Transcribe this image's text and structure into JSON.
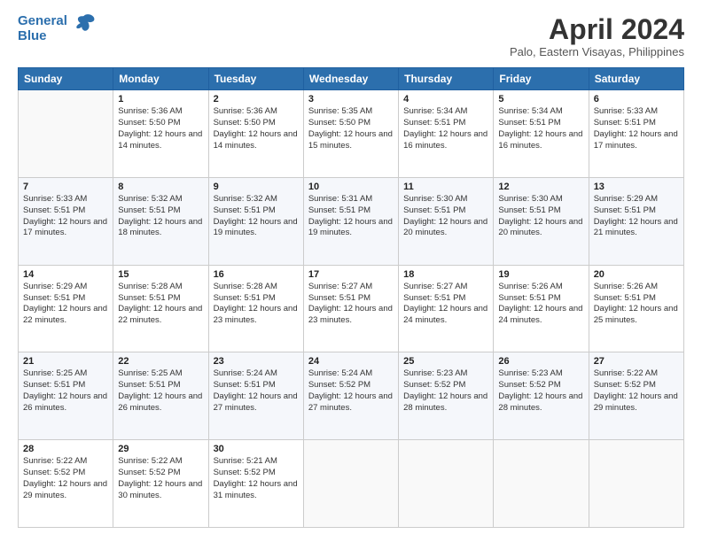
{
  "logo": {
    "line1": "General",
    "line2": "Blue"
  },
  "header": {
    "title": "April 2024",
    "subtitle": "Palo, Eastern Visayas, Philippines"
  },
  "weekdays": [
    "Sunday",
    "Monday",
    "Tuesday",
    "Wednesday",
    "Thursday",
    "Friday",
    "Saturday"
  ],
  "weeks": [
    [
      {
        "day": "",
        "sunrise": "",
        "sunset": "",
        "daylight": ""
      },
      {
        "day": "1",
        "sunrise": "Sunrise: 5:36 AM",
        "sunset": "Sunset: 5:50 PM",
        "daylight": "Daylight: 12 hours and 14 minutes."
      },
      {
        "day": "2",
        "sunrise": "Sunrise: 5:36 AM",
        "sunset": "Sunset: 5:50 PM",
        "daylight": "Daylight: 12 hours and 14 minutes."
      },
      {
        "day": "3",
        "sunrise": "Sunrise: 5:35 AM",
        "sunset": "Sunset: 5:50 PM",
        "daylight": "Daylight: 12 hours and 15 minutes."
      },
      {
        "day": "4",
        "sunrise": "Sunrise: 5:34 AM",
        "sunset": "Sunset: 5:51 PM",
        "daylight": "Daylight: 12 hours and 16 minutes."
      },
      {
        "day": "5",
        "sunrise": "Sunrise: 5:34 AM",
        "sunset": "Sunset: 5:51 PM",
        "daylight": "Daylight: 12 hours and 16 minutes."
      },
      {
        "day": "6",
        "sunrise": "Sunrise: 5:33 AM",
        "sunset": "Sunset: 5:51 PM",
        "daylight": "Daylight: 12 hours and 17 minutes."
      }
    ],
    [
      {
        "day": "7",
        "sunrise": "Sunrise: 5:33 AM",
        "sunset": "Sunset: 5:51 PM",
        "daylight": "Daylight: 12 hours and 17 minutes."
      },
      {
        "day": "8",
        "sunrise": "Sunrise: 5:32 AM",
        "sunset": "Sunset: 5:51 PM",
        "daylight": "Daylight: 12 hours and 18 minutes."
      },
      {
        "day": "9",
        "sunrise": "Sunrise: 5:32 AM",
        "sunset": "Sunset: 5:51 PM",
        "daylight": "Daylight: 12 hours and 19 minutes."
      },
      {
        "day": "10",
        "sunrise": "Sunrise: 5:31 AM",
        "sunset": "Sunset: 5:51 PM",
        "daylight": "Daylight: 12 hours and 19 minutes."
      },
      {
        "day": "11",
        "sunrise": "Sunrise: 5:30 AM",
        "sunset": "Sunset: 5:51 PM",
        "daylight": "Daylight: 12 hours and 20 minutes."
      },
      {
        "day": "12",
        "sunrise": "Sunrise: 5:30 AM",
        "sunset": "Sunset: 5:51 PM",
        "daylight": "Daylight: 12 hours and 20 minutes."
      },
      {
        "day": "13",
        "sunrise": "Sunrise: 5:29 AM",
        "sunset": "Sunset: 5:51 PM",
        "daylight": "Daylight: 12 hours and 21 minutes."
      }
    ],
    [
      {
        "day": "14",
        "sunrise": "Sunrise: 5:29 AM",
        "sunset": "Sunset: 5:51 PM",
        "daylight": "Daylight: 12 hours and 22 minutes."
      },
      {
        "day": "15",
        "sunrise": "Sunrise: 5:28 AM",
        "sunset": "Sunset: 5:51 PM",
        "daylight": "Daylight: 12 hours and 22 minutes."
      },
      {
        "day": "16",
        "sunrise": "Sunrise: 5:28 AM",
        "sunset": "Sunset: 5:51 PM",
        "daylight": "Daylight: 12 hours and 23 minutes."
      },
      {
        "day": "17",
        "sunrise": "Sunrise: 5:27 AM",
        "sunset": "Sunset: 5:51 PM",
        "daylight": "Daylight: 12 hours and 23 minutes."
      },
      {
        "day": "18",
        "sunrise": "Sunrise: 5:27 AM",
        "sunset": "Sunset: 5:51 PM",
        "daylight": "Daylight: 12 hours and 24 minutes."
      },
      {
        "day": "19",
        "sunrise": "Sunrise: 5:26 AM",
        "sunset": "Sunset: 5:51 PM",
        "daylight": "Daylight: 12 hours and 24 minutes."
      },
      {
        "day": "20",
        "sunrise": "Sunrise: 5:26 AM",
        "sunset": "Sunset: 5:51 PM",
        "daylight": "Daylight: 12 hours and 25 minutes."
      }
    ],
    [
      {
        "day": "21",
        "sunrise": "Sunrise: 5:25 AM",
        "sunset": "Sunset: 5:51 PM",
        "daylight": "Daylight: 12 hours and 26 minutes."
      },
      {
        "day": "22",
        "sunrise": "Sunrise: 5:25 AM",
        "sunset": "Sunset: 5:51 PM",
        "daylight": "Daylight: 12 hours and 26 minutes."
      },
      {
        "day": "23",
        "sunrise": "Sunrise: 5:24 AM",
        "sunset": "Sunset: 5:51 PM",
        "daylight": "Daylight: 12 hours and 27 minutes."
      },
      {
        "day": "24",
        "sunrise": "Sunrise: 5:24 AM",
        "sunset": "Sunset: 5:52 PM",
        "daylight": "Daylight: 12 hours and 27 minutes."
      },
      {
        "day": "25",
        "sunrise": "Sunrise: 5:23 AM",
        "sunset": "Sunset: 5:52 PM",
        "daylight": "Daylight: 12 hours and 28 minutes."
      },
      {
        "day": "26",
        "sunrise": "Sunrise: 5:23 AM",
        "sunset": "Sunset: 5:52 PM",
        "daylight": "Daylight: 12 hours and 28 minutes."
      },
      {
        "day": "27",
        "sunrise": "Sunrise: 5:22 AM",
        "sunset": "Sunset: 5:52 PM",
        "daylight": "Daylight: 12 hours and 29 minutes."
      }
    ],
    [
      {
        "day": "28",
        "sunrise": "Sunrise: 5:22 AM",
        "sunset": "Sunset: 5:52 PM",
        "daylight": "Daylight: 12 hours and 29 minutes."
      },
      {
        "day": "29",
        "sunrise": "Sunrise: 5:22 AM",
        "sunset": "Sunset: 5:52 PM",
        "daylight": "Daylight: 12 hours and 30 minutes."
      },
      {
        "day": "30",
        "sunrise": "Sunrise: 5:21 AM",
        "sunset": "Sunset: 5:52 PM",
        "daylight": "Daylight: 12 hours and 31 minutes."
      },
      {
        "day": "",
        "sunrise": "",
        "sunset": "",
        "daylight": ""
      },
      {
        "day": "",
        "sunrise": "",
        "sunset": "",
        "daylight": ""
      },
      {
        "day": "",
        "sunrise": "",
        "sunset": "",
        "daylight": ""
      },
      {
        "day": "",
        "sunrise": "",
        "sunset": "",
        "daylight": ""
      }
    ]
  ]
}
